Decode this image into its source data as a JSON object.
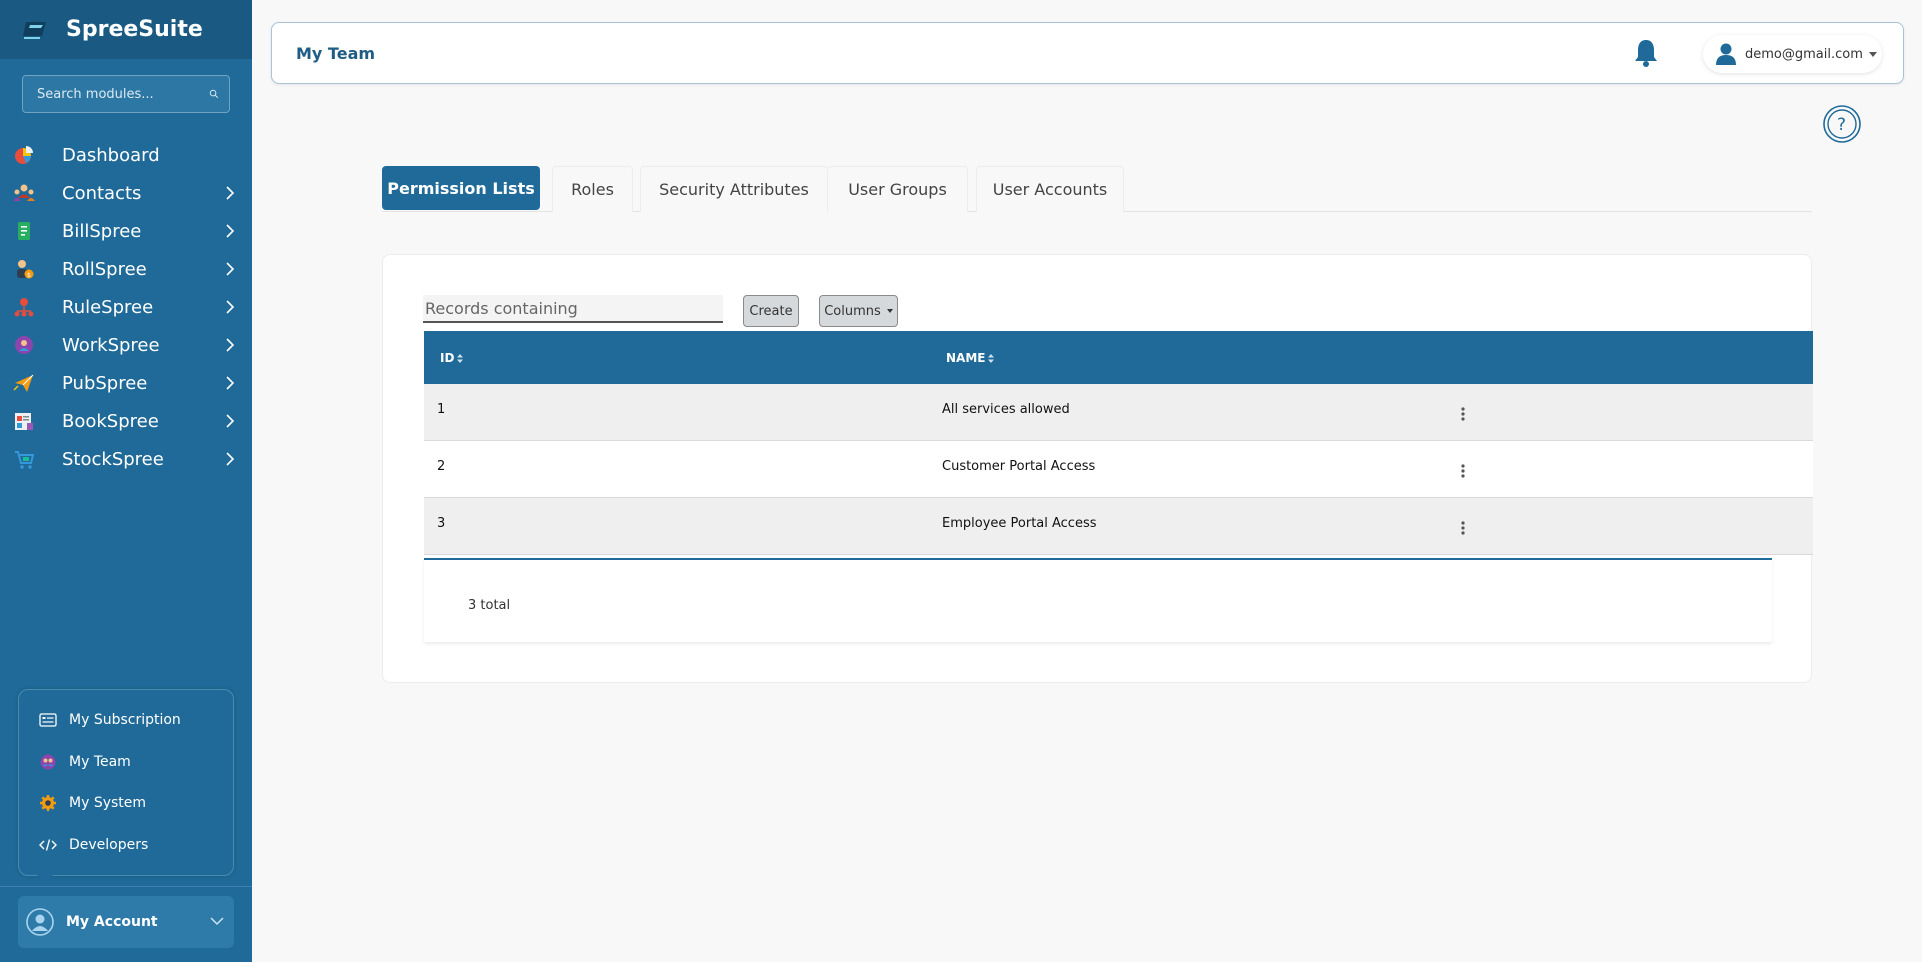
{
  "brand": {
    "name": "SpreeSuite"
  },
  "sidebar": {
    "search_placeholder": "Search modules...",
    "items": [
      {
        "label": "Dashboard",
        "icon": "dashboard-icon",
        "has_children": false
      },
      {
        "label": "Contacts",
        "icon": "contacts-icon",
        "has_children": true
      },
      {
        "label": "BillSpree",
        "icon": "billspree-icon",
        "has_children": true
      },
      {
        "label": "RollSpree",
        "icon": "rollspree-icon",
        "has_children": true
      },
      {
        "label": "RuleSpree",
        "icon": "rulespree-icon",
        "has_children": true
      },
      {
        "label": "WorkSpree",
        "icon": "workspree-icon",
        "has_children": true
      },
      {
        "label": "PubSpree",
        "icon": "pubspree-icon",
        "has_children": true
      },
      {
        "label": "BookSpree",
        "icon": "bookspree-icon",
        "has_children": true
      },
      {
        "label": "StockSpree",
        "icon": "stockspree-icon",
        "has_children": true
      }
    ],
    "account_menu": [
      {
        "label": "My Subscription",
        "icon": "subscription-icon"
      },
      {
        "label": "My Team",
        "icon": "team-icon"
      },
      {
        "label": "My System",
        "icon": "system-gear-icon"
      },
      {
        "label": "Developers",
        "icon": "code-icon"
      }
    ],
    "account_button": {
      "label": "My Account"
    }
  },
  "header": {
    "title": "My Team",
    "user_email": "demo@gmail.com"
  },
  "tabs": [
    {
      "label": "Permission Lists",
      "active": true
    },
    {
      "label": "Roles",
      "active": false
    },
    {
      "label": "Security Attributes",
      "active": false
    },
    {
      "label": "User Groups",
      "active": false
    },
    {
      "label": "User Accounts",
      "active": false
    }
  ],
  "toolbar": {
    "search_placeholder": "Records containing",
    "create_label": "Create",
    "columns_label": "Columns"
  },
  "table": {
    "columns": [
      "ID",
      "NAME"
    ],
    "rows": [
      {
        "id": "1",
        "name": "All services allowed"
      },
      {
        "id": "2",
        "name": "Customer Portal Access"
      },
      {
        "id": "3",
        "name": "Employee Portal Access"
      }
    ],
    "footer_total": "3 total"
  },
  "colors": {
    "primary": "#1f6a98",
    "sidebar_dark": "#1a5a82",
    "header_title": "#1f5d85"
  }
}
